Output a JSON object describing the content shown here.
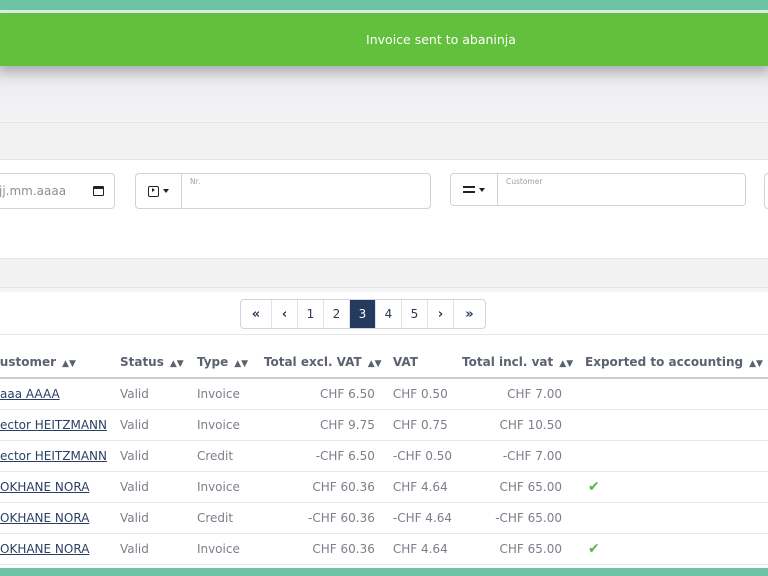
{
  "toast": {
    "message": "Invoice sent to abaninja"
  },
  "filters": {
    "date_placeholder": "jj.mm.aaaa",
    "nr_label": "Nr.",
    "customer_label": "Customer"
  },
  "pagination": {
    "pages": [
      "1",
      "2",
      "3",
      "4",
      "5"
    ],
    "current": "3"
  },
  "table": {
    "columns": [
      "Customer",
      "Status",
      "Type",
      "Total excl. VAT",
      "VAT",
      "Total incl. vat",
      "Exported to accounting"
    ],
    "rows": [
      {
        "customer": "aaa AAAA",
        "status": "Valid",
        "type": "Invoice",
        "excl": "CHF 6.50",
        "vat": "CHF 0.50",
        "incl": "CHF 7.00",
        "exported": false
      },
      {
        "customer": "ector HEITZMANN",
        "status": "Valid",
        "type": "Invoice",
        "excl": "CHF 9.75",
        "vat": "CHF 0.75",
        "incl": "CHF 10.50",
        "exported": false
      },
      {
        "customer": "ector HEITZMANN",
        "status": "Valid",
        "type": "Credit",
        "excl": "-CHF 6.50",
        "vat": "-CHF 0.50",
        "incl": "-CHF 7.00",
        "exported": false
      },
      {
        "customer": "OKHANE NORA",
        "status": "Valid",
        "type": "Invoice",
        "excl": "CHF 60.36",
        "vat": "CHF 4.64",
        "incl": "CHF 65.00",
        "exported": true
      },
      {
        "customer": "OKHANE NORA",
        "status": "Valid",
        "type": "Credit",
        "excl": "-CHF 60.36",
        "vat": "-CHF 4.64",
        "incl": "-CHF 65.00",
        "exported": false
      },
      {
        "customer": "OKHANE NORA",
        "status": "Valid",
        "type": "Invoice",
        "excl": "CHF 60.36",
        "vat": "CHF 4.64",
        "incl": "CHF 65.00",
        "exported": true
      }
    ]
  },
  "colors": {
    "toast": "#62c03c",
    "accent_strip": "#6cc4a4",
    "active_page": "#243a5e",
    "check": "#5cb548"
  }
}
